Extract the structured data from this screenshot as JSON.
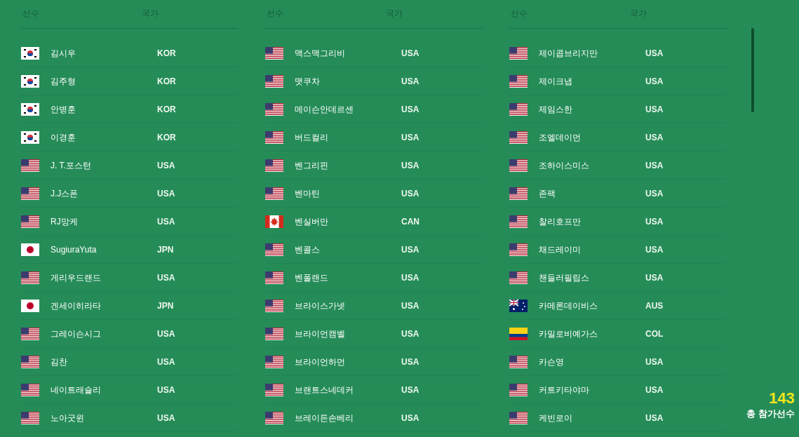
{
  "columns": [
    {
      "headers": [
        "선수",
        "국가"
      ],
      "rows": [
        {
          "name": "김시우",
          "country": "KOR",
          "kind": "kr"
        },
        {
          "name": "김주형",
          "country": "KOR",
          "kind": "kr"
        },
        {
          "name": "안병훈",
          "country": "KOR",
          "kind": "kr"
        },
        {
          "name": "이경훈",
          "country": "KOR",
          "kind": "kr"
        },
        {
          "name": "J. T.포스턴",
          "country": "USA",
          "kind": "us"
        },
        {
          "name": "J.J스폰",
          "country": "USA",
          "kind": "us"
        },
        {
          "name": "RJ망케",
          "country": "USA",
          "kind": "us"
        },
        {
          "name": "SugiuraYuta",
          "country": "JPN",
          "kind": "jp"
        },
        {
          "name": "게리우드랜드",
          "country": "USA",
          "kind": "us"
        },
        {
          "name": "겐세이히라타",
          "country": "JPN",
          "kind": "jp"
        },
        {
          "name": "그레이슨시그",
          "country": "USA",
          "kind": "us"
        },
        {
          "name": "김찬",
          "country": "USA",
          "kind": "us"
        },
        {
          "name": "네이트래슐리",
          "country": "USA",
          "kind": "us"
        },
        {
          "name": "노아굿윈",
          "country": "USA",
          "kind": "us"
        }
      ]
    },
    {
      "headers": [
        "선수",
        "국가"
      ],
      "rows": [
        {
          "name": "맥스맥그리비",
          "country": "USA",
          "kind": "us"
        },
        {
          "name": "맷쿠차",
          "country": "USA",
          "kind": "us"
        },
        {
          "name": "메이슨안데르센",
          "country": "USA",
          "kind": "us"
        },
        {
          "name": "버드컬리",
          "country": "USA",
          "kind": "us"
        },
        {
          "name": "벤그리핀",
          "country": "USA",
          "kind": "us"
        },
        {
          "name": "벤마틴",
          "country": "USA",
          "kind": "us"
        },
        {
          "name": "벤실버만",
          "country": "CAN",
          "kind": "ca"
        },
        {
          "name": "벤콜스",
          "country": "USA",
          "kind": "us"
        },
        {
          "name": "벤폴랜드",
          "country": "USA",
          "kind": "us"
        },
        {
          "name": "브라이스가넷",
          "country": "USA",
          "kind": "us"
        },
        {
          "name": "브라이언캠벨",
          "country": "USA",
          "kind": "us"
        },
        {
          "name": "브라이언하먼",
          "country": "USA",
          "kind": "us"
        },
        {
          "name": "브랜트스네데커",
          "country": "USA",
          "kind": "us"
        },
        {
          "name": "브레이든손베리",
          "country": "USA",
          "kind": "us"
        }
      ]
    },
    {
      "headers": [
        "선수",
        "국가"
      ],
      "rows": [
        {
          "name": "제이콥브리지만",
          "country": "USA",
          "kind": "us"
        },
        {
          "name": "제이크냅",
          "country": "USA",
          "kind": "us"
        },
        {
          "name": "제임스한",
          "country": "USA",
          "kind": "us"
        },
        {
          "name": "조엘데이먼",
          "country": "USA",
          "kind": "us"
        },
        {
          "name": "조하이스미스",
          "country": "USA",
          "kind": "us"
        },
        {
          "name": "존팩",
          "country": "USA",
          "kind": "us"
        },
        {
          "name": "찰리호프만",
          "country": "USA",
          "kind": "us"
        },
        {
          "name": "채드레이미",
          "country": "USA",
          "kind": "us"
        },
        {
          "name": "챈들러필립스",
          "country": "USA",
          "kind": "us"
        },
        {
          "name": "카메론데이비스",
          "country": "AUS",
          "kind": "au"
        },
        {
          "name": "카밀로비예가스",
          "country": "COL",
          "kind": "co"
        },
        {
          "name": "카슨영",
          "country": "USA",
          "kind": "us"
        },
        {
          "name": "커트키타야마",
          "country": "USA",
          "kind": "us"
        },
        {
          "name": "케빈로이",
          "country": "USA",
          "kind": "us"
        }
      ]
    }
  ],
  "total": {
    "count": "143",
    "label": "총 참가선수"
  }
}
